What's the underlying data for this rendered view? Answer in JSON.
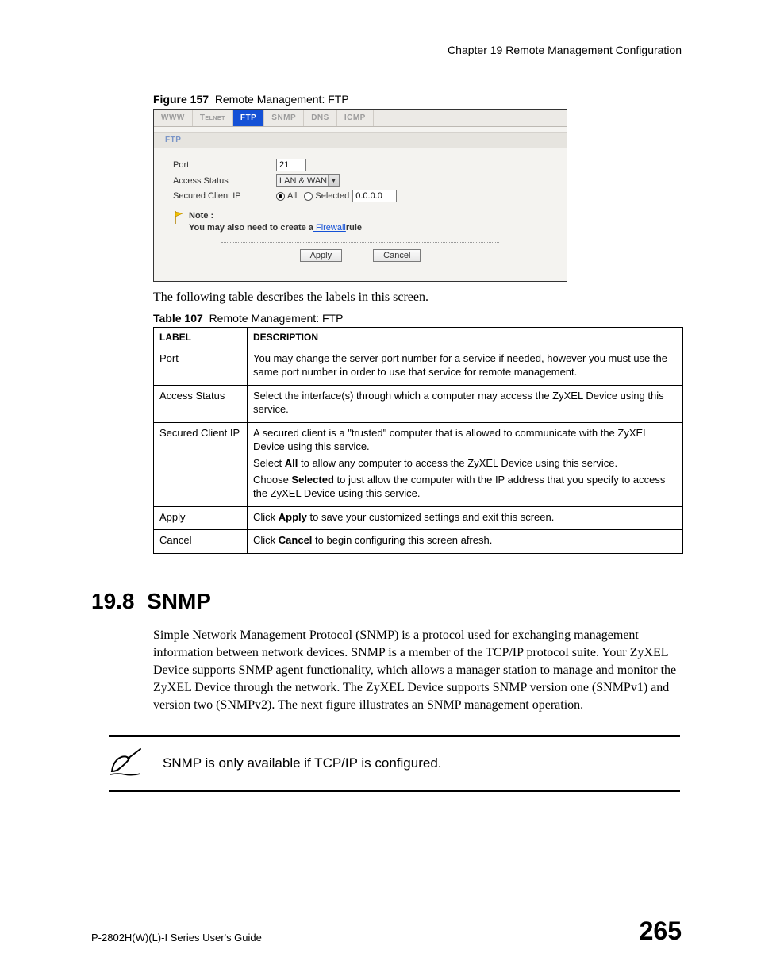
{
  "header": {
    "chapter": "Chapter 19 Remote Management Configuration"
  },
  "figure": {
    "label": "Figure 157",
    "title": "Remote Management: FTP"
  },
  "shot": {
    "tabs": [
      "WWW",
      "Telnet",
      "FTP",
      "SNMP",
      "DNS",
      "ICMP"
    ],
    "active_tab": "FTP",
    "group": "FTP",
    "rows": {
      "port_label": "Port",
      "port_value": "21",
      "access_label": "Access Status",
      "access_value": "LAN & WAN",
      "secured_label": "Secured Client IP",
      "radio_all": "All",
      "radio_selected": "Selected",
      "ip_value": "0.0.0.0"
    },
    "note": {
      "title": "Note :",
      "line_a": "You may also need to create a",
      "firewall": " Firewall",
      "line_b": "rule"
    },
    "buttons": {
      "apply": "Apply",
      "cancel": "Cancel"
    }
  },
  "lead_text": "The following table describes the labels in this screen.",
  "table": {
    "label": "Table 107",
    "title": "Remote Management: FTP",
    "head": {
      "c1": "LABEL",
      "c2": "DESCRIPTION"
    },
    "rows": [
      {
        "label": "Port",
        "desc": [
          "You may change the server port number for a service if needed, however you must use the same port number in order to use that service for remote management."
        ]
      },
      {
        "label": "Access Status",
        "desc": [
          "Select the interface(s) through which a computer may access the ZyXEL Device using this service."
        ]
      },
      {
        "label": "Secured Client IP",
        "desc": [
          "A secured client is a \"trusted\" computer that is allowed to communicate with the ZyXEL Device using this service.",
          "Select <b>All</b> to allow any computer to access the ZyXEL Device using this service.",
          "Choose <b>Selected</b> to just allow the computer with the IP address that you specify to access the ZyXEL Device using this service."
        ]
      },
      {
        "label": "Apply",
        "desc": [
          "Click <b>Apply</b> to save your customized settings and exit this screen."
        ]
      },
      {
        "label": "Cancel",
        "desc": [
          "Click <b>Cancel</b> to begin configuring this screen afresh."
        ]
      }
    ]
  },
  "section": {
    "number": "19.8",
    "title": "SNMP"
  },
  "para": "Simple Network Management Protocol (SNMP) is a protocol used for exchanging management information between network devices. SNMP is a member of the TCP/IP protocol suite. Your ZyXEL Device supports SNMP agent functionality, which allows a manager station to manage and monitor the ZyXEL Device through the network. The ZyXEL Device supports SNMP version one (SNMPv1) and version two (SNMPv2). The next figure illustrates an SNMP management operation.",
  "callout": "SNMP is only available if TCP/IP is configured.",
  "footer": {
    "guide": "P-2802H(W)(L)-I Series User's Guide",
    "page": "265"
  }
}
